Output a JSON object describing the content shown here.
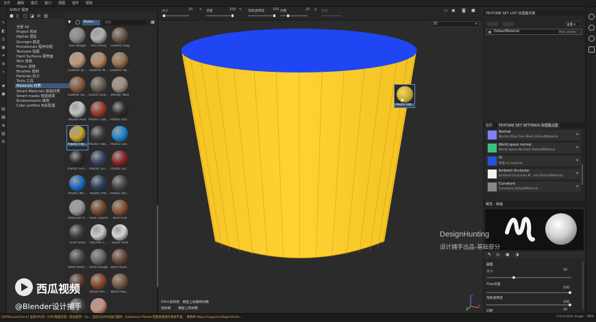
{
  "menu": [
    "文件",
    "编辑",
    "模式",
    "窗口",
    "视图",
    "插件",
    "帮助"
  ],
  "shelf": {
    "title": "SHELF 展架",
    "search_placeholder": "搜索",
    "filter_tag": "Materi...",
    "categories": [
      "全部 All",
      "Project 项目",
      "Alphas 透贴",
      "Grunges 脏迹",
      "Procedurals 程序纹理",
      "Textures 贴图",
      "Hard Surfaces 硬表面",
      "Skin 皮肤",
      "Filters 滤镜",
      "Brushes 笔刷",
      "Particles 粒子",
      "Tools 工具",
      "Materials 材质",
      "Smart Materials 智能材质",
      "Smart masks 智能遮罩",
      "Environments 環境",
      "Color profiles 色彩配置"
    ],
    "selected_category": "Materials 材质",
    "materials": [
      {
        "label": "Iron Rough",
        "color": "#8a8a8a"
      },
      {
        "label": "Iron Shiny",
        "color": "#b0b0b0"
      },
      {
        "label": "Leather bag",
        "color": "#6d5848"
      },
      {
        "label": "Leather Bi...",
        "color": "#c39a7d"
      },
      {
        "label": "Leather M...",
        "color": "#b48763"
      },
      {
        "label": "Leather Ro...",
        "color": "#9b7250"
      },
      {
        "label": "Leather So...",
        "color": "#8a5c3a"
      },
      {
        "label": "Lizard Scal...",
        "color": "#6a5f4f"
      },
      {
        "label": "Mortar Wall",
        "color": "#9d8f80"
      },
      {
        "label": "Nickel Pure",
        "color": "#c4c4c4"
      },
      {
        "label": "Plastic Cab...",
        "color": "#a03a2a"
      },
      {
        "label": "Plastic Dia...",
        "color": "#2f2f2f"
      },
      {
        "label": "Plastic Fab...",
        "color": "#c8a630"
      },
      {
        "label": "Plastic Fab...",
        "color": "#3c3c3c"
      },
      {
        "label": "Plastic Glo...",
        "color": "#1e88d4"
      },
      {
        "label": "Plastic Gra...",
        "color": "#2c2c2c"
      },
      {
        "label": "Plastic Gri...",
        "color": "#3a4466"
      },
      {
        "label": "Plastic Gri...",
        "color": "#8f2525"
      },
      {
        "label": "Plastic Ma...",
        "color": "#1f6fcc"
      },
      {
        "label": "Plastic PVC",
        "color": "#2d4560"
      },
      {
        "label": "Plastic Stri...",
        "color": "#4a4a4a"
      },
      {
        "label": "Platinum P...",
        "color": "#9a9a9a"
      },
      {
        "label": "Rust Coarse",
        "color": "#7a4a2e"
      },
      {
        "label": "Rust Fine",
        "color": "#8c5334"
      },
      {
        "label": "Scarf wool",
        "color": "#3e3e3e"
      },
      {
        "label": "Silicone C...",
        "color": "#c9c9c9"
      },
      {
        "label": "Silver Pure",
        "color": "#d6d6d6"
      },
      {
        "label": "Steel Paint...",
        "color": "#4a4a4a"
      },
      {
        "label": "Steel Rough",
        "color": "#6a6a6a"
      },
      {
        "label": "Steel Rust...",
        "color": "#6b4a38"
      },
      {
        "label": "",
        "color": "#5a3d2e"
      },
      {
        "label": "Wood Am...",
        "color": "#8a4a2a"
      },
      {
        "label": "Wood Rou...",
        "color": "#7a5a40"
      },
      {
        "label": "",
        "color": "#4a4a4a"
      },
      {
        "label": "Zombie B...",
        "color": "#d09080"
      }
    ],
    "selected_material_index": 12
  },
  "viewport_toolbar": {
    "size_label": "大小",
    "size_value": "10",
    "flow_label": "流量",
    "flow_value": "100",
    "opacity_label": "笔刷透明度",
    "opacity_value": "100",
    "angle_label": "间距",
    "angle_value": "20",
    "extra_label": "抖动",
    "display_select": "3D"
  },
  "viewport": {
    "drag_item_label": "Plastic Fab...",
    "hint1_key": "Ctrl+鼠标拖",
    "hint1_text": "模型上局部的材质",
    "hint2_key": "鼠标拖",
    "hint2_text": "模型上的材质",
    "axis_x": "X",
    "axis_y": "Y",
    "axis_z": "Z"
  },
  "texture_set_list": {
    "title": "TEXTURE SET LIST 纹理集列表",
    "settings_button": "设置",
    "material_name": "DefaultMaterial",
    "shader_select": "Main shader"
  },
  "texture_set_settings": {
    "tab_layers": "图层",
    "title": "TEXTURE SET SETTINGS 纹理集设置",
    "maps": [
      {
        "name": "Normal",
        "sub": "Normal Map from Mesh DefaultMaterial",
        "color": "#8080ff"
      },
      {
        "name": "World space normal",
        "sub": "World Space Normals DefaultMaterial",
        "color": "#3fbf7f"
      },
      {
        "name": "ID",
        "sub": "纹理 id_material",
        "color": "#2255dd"
      },
      {
        "name": "Ambient Occlusion",
        "sub": "Ambient Occlusion M...esh DefaultMaterial",
        "color": "#f2f2f2"
      },
      {
        "name": "Curvature",
        "sub": "Curvature DefaultMaterial",
        "color": "#888888"
      }
    ]
  },
  "properties": {
    "title": "属性 - 绘画",
    "section": "画笔",
    "size_label": "大小",
    "size_value": "10",
    "flow_label": "Flow流量",
    "flow_value": "100",
    "opacity_label": "笔刷透明度",
    "opacity_value": "100",
    "spacing_label": "间距",
    "spacing_value": "20"
  },
  "status": {
    "text": "[GPUIssuesCheck] 当前GPU的（GPU性能异常）驱动程序：Co... 当您在长时间运行着时，Substance Painter可能会使操作系统不安。 请参阅 https://support.allegorithmic...",
    "cache": "Cache Disk Usage:",
    "percent": "98%"
  },
  "watermarks": {
    "brand": "DesignHunting",
    "brand_sub": "设计捕手出品-基础部分",
    "xigua": "西瓜视频",
    "handle": "@Blender设计捕手"
  },
  "colors": {
    "accent": "#3c5b7b",
    "cup_yellow": "#f7c92a",
    "cup_top_blue": "#1f46f2"
  }
}
